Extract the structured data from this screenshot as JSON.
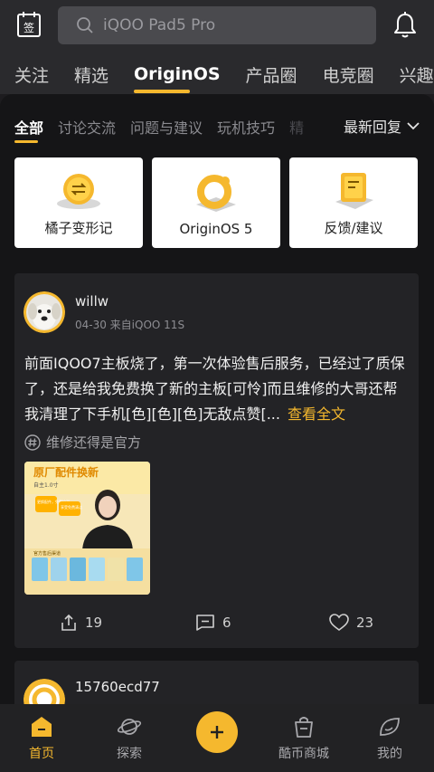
{
  "header": {
    "search_placeholder": "iQOO Pad5 Pro"
  },
  "channels": [
    "关注",
    "精选",
    "OriginOS",
    "产品圈",
    "电竞圈",
    "兴趣圈"
  ],
  "subtabs": [
    "全部",
    "讨论交流",
    "问题与建议",
    "玩机技巧",
    "精"
  ],
  "sort_label": "最新回复",
  "cards": [
    {
      "label": "橘子变形记",
      "icon": "orange-icon"
    },
    {
      "label": "OriginOS 5",
      "icon": "origin-ring-icon"
    },
    {
      "label": "反馈/建议",
      "icon": "feedback-doc-icon"
    }
  ],
  "post1": {
    "username": "willw",
    "meta": "04-30 来自iQOO 11S",
    "content": "前面IQOO7主板烧了，第一次体验售后服务，已经过了质保了，还是给我免费换了新的主板[可怜]而且维修的大哥还帮我清理了下手机[色][色][色]无敌点赞[...",
    "more_label": "查看全文",
    "topic": "维修还得是官方",
    "thumb": {
      "title": "原厂配件换新",
      "subtitle": "自主1.0寸",
      "bubble1": "更换配件，免费检测",
      "bubble2": "享受免费清洁",
      "footer": "官方售后渠道"
    },
    "share_count": "19",
    "comment_count": "6",
    "like_count": "23"
  },
  "post2": {
    "username": "15760ecd77"
  },
  "nav": [
    {
      "label": "首页"
    },
    {
      "label": "探索"
    },
    {
      "label": "酷币商城"
    },
    {
      "label": "我的"
    }
  ],
  "fab_symbol": "+",
  "colors": {
    "accent": "#f5b82e",
    "background": "#151517",
    "card": "#232326"
  }
}
